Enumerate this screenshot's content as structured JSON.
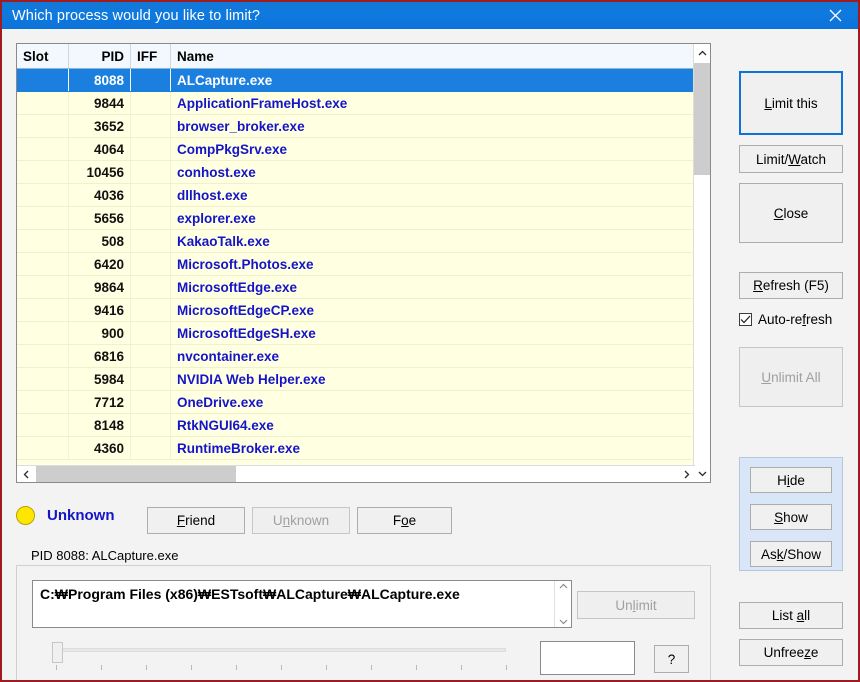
{
  "window": {
    "title": "Which process would you like to limit?",
    "close_icon": "close-icon"
  },
  "process_list": {
    "columns": [
      "Slot",
      "PID",
      "IFF",
      "Name"
    ],
    "rows": [
      {
        "slot": "",
        "pid": "8088",
        "iff": "",
        "name": "ALCapture.exe",
        "selected": true
      },
      {
        "slot": "",
        "pid": "9844",
        "iff": "",
        "name": "ApplicationFrameHost.exe",
        "selected": false
      },
      {
        "slot": "",
        "pid": "3652",
        "iff": "",
        "name": "browser_broker.exe",
        "selected": false
      },
      {
        "slot": "",
        "pid": "4064",
        "iff": "",
        "name": "CompPkgSrv.exe",
        "selected": false
      },
      {
        "slot": "",
        "pid": "10456",
        "iff": "",
        "name": "conhost.exe",
        "selected": false
      },
      {
        "slot": "",
        "pid": "4036",
        "iff": "",
        "name": "dllhost.exe",
        "selected": false
      },
      {
        "slot": "",
        "pid": "5656",
        "iff": "",
        "name": "explorer.exe",
        "selected": false
      },
      {
        "slot": "",
        "pid": "508",
        "iff": "",
        "name": "KakaoTalk.exe",
        "selected": false
      },
      {
        "slot": "",
        "pid": "6420",
        "iff": "",
        "name": "Microsoft.Photos.exe",
        "selected": false
      },
      {
        "slot": "",
        "pid": "9864",
        "iff": "",
        "name": "MicrosoftEdge.exe",
        "selected": false
      },
      {
        "slot": "",
        "pid": "9416",
        "iff": "",
        "name": "MicrosoftEdgeCP.exe",
        "selected": false
      },
      {
        "slot": "",
        "pid": "900",
        "iff": "",
        "name": "MicrosoftEdgeSH.exe",
        "selected": false
      },
      {
        "slot": "",
        "pid": "6816",
        "iff": "",
        "name": "nvcontainer.exe",
        "selected": false
      },
      {
        "slot": "",
        "pid": "5984",
        "iff": "",
        "name": "NVIDIA Web Helper.exe",
        "selected": false
      },
      {
        "slot": "",
        "pid": "7712",
        "iff": "",
        "name": "OneDrive.exe",
        "selected": false
      },
      {
        "slot": "",
        "pid": "8148",
        "iff": "",
        "name": "RtkNGUI64.exe",
        "selected": false
      },
      {
        "slot": "",
        "pid": "4360",
        "iff": "",
        "name": "RuntimeBroker.exe",
        "selected": false
      }
    ]
  },
  "iff_section": {
    "status_label": "Unknown",
    "status_color": "#ffe600",
    "friend_button": "Friend",
    "unknown_button": "Unknown",
    "foe_button": "Foe"
  },
  "pid_group": {
    "legend": "PID 8088: ALCapture.exe",
    "path_value": "C:₩Program Files (x86)₩ESTsoft₩ALCapture₩ALCapture.exe",
    "unlimit_button": "Unlimit",
    "value_field": "",
    "help_button": "?"
  },
  "right_panel": {
    "limit_this": "Limit this",
    "limit_watch": "Limit/Watch",
    "close": "Close",
    "refresh": "Refresh (F5)",
    "auto_refresh": "Auto-refresh",
    "auto_refresh_checked": true,
    "unlimit_all": "Unlimit All",
    "hide": "Hide",
    "show": "Show",
    "ask_show": "Ask/Show",
    "list_all": "List all",
    "unfreeze": "Unfreeze"
  },
  "colors": {
    "titlebar": "#0e7ae0",
    "window_border": "#9e1b20",
    "selection": "#1b7fe0",
    "list_bg": "#ffffe1",
    "process_name": "#1414c8",
    "hide_panel": "#d9e6f7"
  }
}
